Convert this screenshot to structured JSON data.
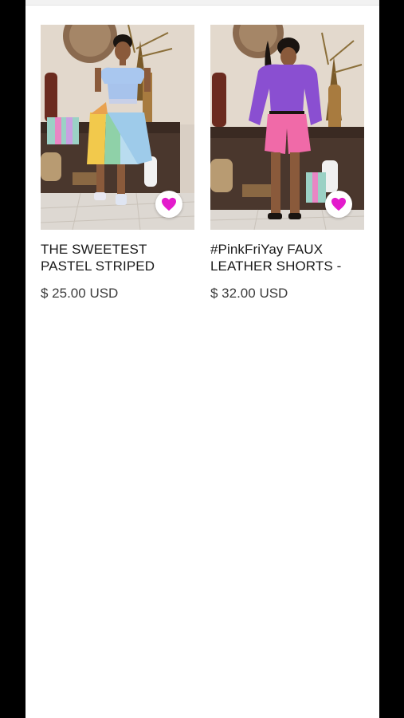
{
  "products": [
    {
      "title": "THE SWEETEST PASTEL STRIPED",
      "price": "$ 25.00 USD",
      "favorite_icon": "heart-icon",
      "favorite_color": "#e31bcc"
    },
    {
      "title": "#PinkFriYay FAUX LEATHER SHORTS -",
      "price": "$ 32.00 USD",
      "favorite_icon": "heart-icon",
      "favorite_color": "#e31bcc"
    }
  ]
}
